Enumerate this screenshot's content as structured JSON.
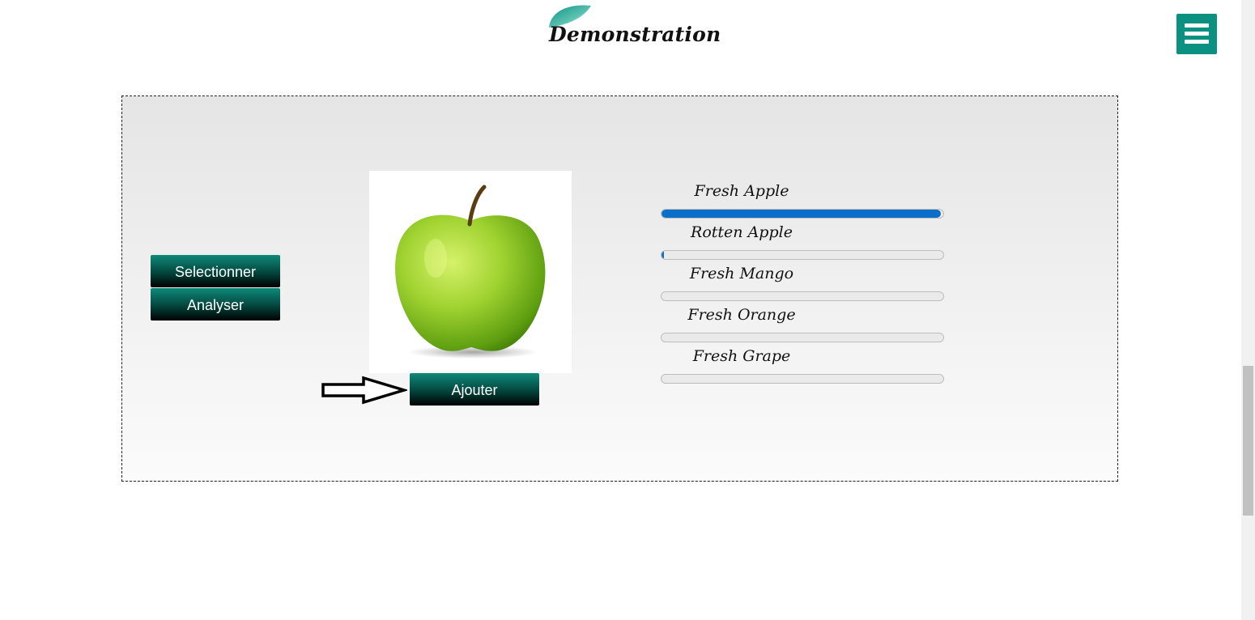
{
  "header": {
    "logo_text": "Demonstration",
    "logo_leaf_color": "#0b9181",
    "menu_icon": "hamburger-menu-icon"
  },
  "panel": {
    "buttons": {
      "select_label": "Selectionner",
      "analyze_label": "Analyser",
      "add_label": "Ajouter"
    },
    "image": {
      "subject": "green-apple"
    },
    "arrow_icon": "right-arrow-icon",
    "results": [
      {
        "label": "Fresh Apple",
        "progress": 0.99
      },
      {
        "label": "Rotten Apple",
        "progress": 0.01
      },
      {
        "label": "Fresh Mango",
        "progress": 0
      },
      {
        "label": "Fresh Orange",
        "progress": 0
      },
      {
        "label": "Fresh Grape",
        "progress": 0
      }
    ]
  },
  "colors": {
    "accent": "#0b9181",
    "progress": "#0a6fc9"
  }
}
